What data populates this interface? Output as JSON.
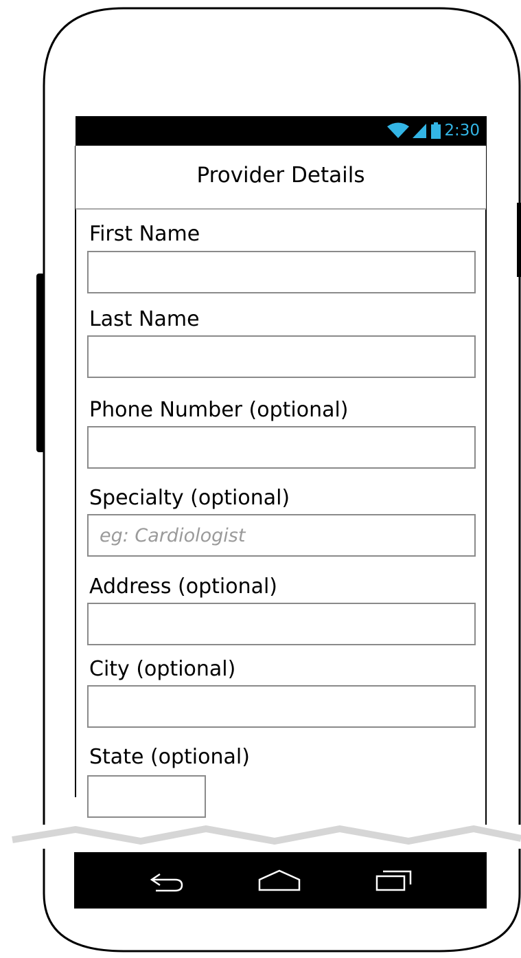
{
  "status_bar": {
    "time": "2:30",
    "icons": [
      "wifi-icon",
      "signal-icon",
      "battery-icon"
    ],
    "accent_color": "#33b5e5"
  },
  "app_bar": {
    "title": "Provider Details"
  },
  "form": {
    "fields": [
      {
        "label": "First Name",
        "value": "",
        "placeholder": ""
      },
      {
        "label": "Last Name",
        "value": "",
        "placeholder": ""
      },
      {
        "label": "Phone Number (optional)",
        "value": "",
        "placeholder": ""
      },
      {
        "label": "Specialty (optional)",
        "value": "",
        "placeholder": "eg: Cardiologist"
      },
      {
        "label": "Address (optional)",
        "value": "",
        "placeholder": ""
      },
      {
        "label": "City (optional)",
        "value": "",
        "placeholder": ""
      },
      {
        "label": "State (optional)",
        "value": "",
        "placeholder": ""
      }
    ]
  },
  "nav_bar": {
    "buttons": [
      "back-icon",
      "home-icon",
      "recent-apps-icon"
    ]
  }
}
